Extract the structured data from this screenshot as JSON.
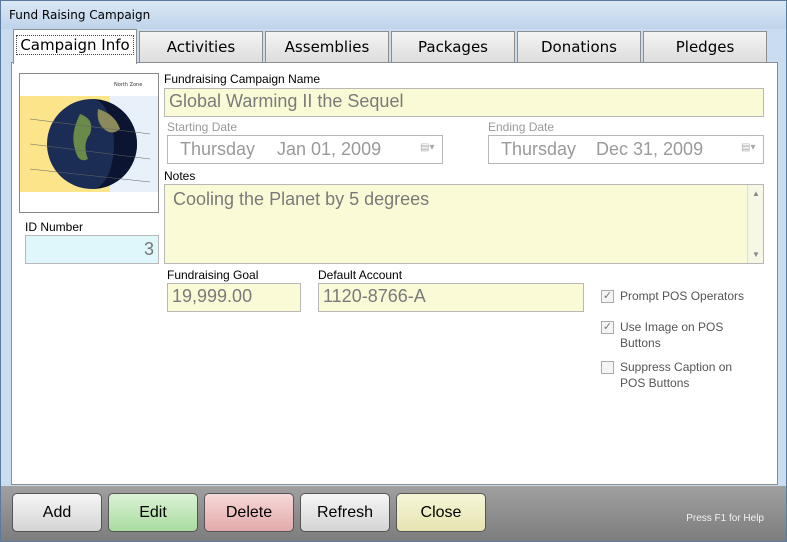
{
  "window": {
    "title": "Fund Raising Campaign"
  },
  "tabs": [
    {
      "label": "Campaign Info",
      "active": true
    },
    {
      "label": "Activities",
      "active": false
    },
    {
      "label": "Assemblies",
      "active": false
    },
    {
      "label": "Packages",
      "active": false
    },
    {
      "label": "Donations",
      "active": false
    },
    {
      "label": "Pledges",
      "active": false
    }
  ],
  "form": {
    "campaign_name_label": "Fundraising Campaign Name",
    "campaign_name_value": "Global Warming II the Sequel",
    "starting_date_label": "Starting Date",
    "starting_date_weekday": "Thursday",
    "starting_date_value": "Jan 01, 2009",
    "ending_date_label": "Ending Date",
    "ending_date_weekday": "Thursday",
    "ending_date_value": "Dec 31, 2009",
    "notes_label": "Notes",
    "notes_value": "Cooling the Planet by 5 degrees",
    "id_label": "ID Number",
    "id_value": "3",
    "goal_label": "Fundraising Goal",
    "goal_value": "19,999.00",
    "account_label": "Default Account",
    "account_value": "1120-8766-A",
    "image_caption": "North Zone"
  },
  "checkboxes": [
    {
      "label": "Prompt POS Operators",
      "checked": true
    },
    {
      "label": "Use Image on POS Buttons",
      "checked": true
    },
    {
      "label": "Suppress Caption on POS Buttons",
      "checked": false
    }
  ],
  "buttons": {
    "add": "Add",
    "edit": "Edit",
    "delete": "Delete",
    "refresh": "Refresh",
    "close": "Close"
  },
  "help_text": "Press F1 for Help",
  "colors": {
    "field_yellow": "#fafbd6",
    "field_blue": "#dff7fb",
    "edit_green": "#a9dca0",
    "delete_red": "#e2aaaa",
    "close_yellow": "#e6e4b0"
  }
}
